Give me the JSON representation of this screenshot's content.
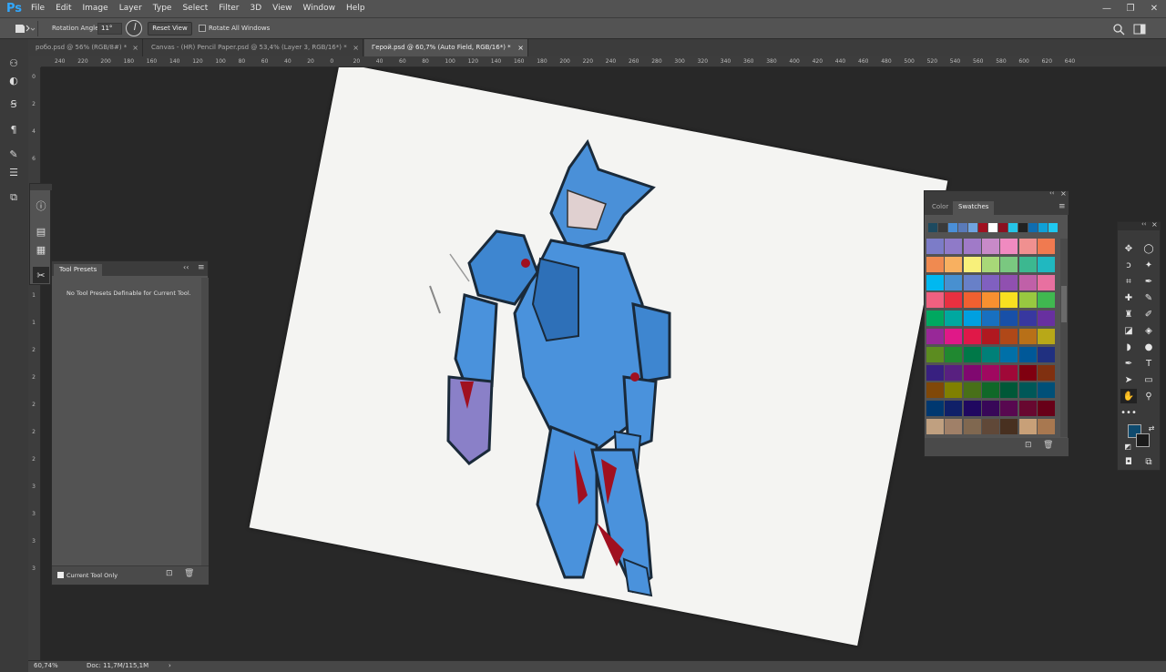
{
  "app": {
    "logo": "Ps",
    "menu": [
      "File",
      "Edit",
      "Image",
      "Layer",
      "Type",
      "Select",
      "Filter",
      "3D",
      "View",
      "Window",
      "Help"
    ],
    "window_controls": {
      "minimize": "—",
      "restore": "❐",
      "close": "✕"
    }
  },
  "options": {
    "rotation_label": "Rotation Angle:",
    "rotation_value": "11°",
    "reset_view": "Reset View",
    "rotate_all": "Rotate All Windows"
  },
  "tabs": [
    {
      "label": "poбо.psd @ 56% (RGB/8#) *",
      "active": false
    },
    {
      "label": "Canvas - (HR) Pencil Paper.psd @ 53,4% (Layer 3, RGB/16*) *",
      "active": false
    },
    {
      "label": "Герой.psd @ 60,7% (Auto Field, RGB/16*) *",
      "active": true
    }
  ],
  "ruler": {
    "h": [
      "240",
      "220",
      "200",
      "180",
      "160",
      "140",
      "120",
      "100",
      "80",
      "60",
      "40",
      "20",
      "0",
      "20",
      "40",
      "60",
      "80",
      "100",
      "120",
      "140",
      "160",
      "180",
      "200",
      "220",
      "240",
      "260",
      "280",
      "300",
      "320",
      "340",
      "360",
      "380",
      "400",
      "420",
      "440",
      "460",
      "480",
      "500",
      "520",
      "540",
      "560",
      "580",
      "600",
      "620",
      "640"
    ],
    "v": [
      "0",
      "2",
      "4",
      "6",
      "8",
      "1",
      "1",
      "1",
      "1",
      "1",
      "2",
      "2",
      "2",
      "2",
      "2",
      "3",
      "3",
      "3",
      "3"
    ]
  },
  "tool_presets": {
    "tab_label": "Tool Presets",
    "empty_message": "No Tool Presets Definable for Current Tool.",
    "current_tool_only": "Current Tool Only",
    "collapse_glyph": "‹‹",
    "menu_glyph": "≡"
  },
  "swatches": {
    "tab_color": "Color",
    "tab_swatches": "Swatches",
    "recent": [
      "#1d4a60",
      "#3a3a3a",
      "#4a8fd8",
      "#5a7ab8",
      "#6fa3e0",
      "#a01020",
      "#ffffff",
      "#8a1020",
      "#25c4e8",
      "#222222",
      "#0f6db0",
      "#0fa0d8",
      "#1fc8f0"
    ],
    "grid": [
      [
        "#7c7cc8",
        "#8f7ac8",
        "#a07ac8",
        "#c88ac8",
        "#f08ac0",
        "#f09090",
        "#f07a50"
      ],
      [
        "#f08a50",
        "#f8b060",
        "#f8f07a",
        "#a8d878",
        "#7ac880",
        "#3cb890",
        "#20b8c0"
      ],
      [
        "#00b8f0",
        "#4890d0",
        "#6880c8",
        "#8060c0",
        "#9050b0",
        "#c060a8",
        "#e870a0"
      ],
      [
        "#f06080",
        "#e83040",
        "#f06030",
        "#f89030",
        "#f8e020",
        "#98c840",
        "#40b850"
      ],
      [
        "#00a860",
        "#00a8a0",
        "#00a0e0",
        "#1870c0",
        "#1850a8",
        "#3838a0",
        "#6830a0"
      ],
      [
        "#982898",
        "#e01888",
        "#e01848",
        "#b01820",
        "#b04818",
        "#b87018",
        "#b8a818"
      ],
      [
        "#5c8c20",
        "#208830",
        "#007848",
        "#008078",
        "#0070a8",
        "#005898",
        "#203080"
      ],
      [
        "#382080",
        "#582080",
        "#800870",
        "#a00860",
        "#a00838",
        "#800010",
        "#803010"
      ],
      [
        "#804808",
        "#808000",
        "#487018",
        "#106828",
        "#005838",
        "#005858",
        "#005078"
      ],
      [
        "#003870",
        "#102068",
        "#200860",
        "#380858",
        "#580850",
        "#680830",
        "#680018"
      ],
      [
        "#c0a080",
        "#a08068",
        "#806850",
        "#604838",
        "#483020",
        "#c8a078",
        "#a87850"
      ]
    ]
  },
  "status": {
    "zoom": "60,74%",
    "doc": "Doc: 11,7M/115,1M",
    "arrow": "›"
  },
  "colors": {
    "foreground": "#0e4a6e",
    "background": "#1a1a1a"
  }
}
